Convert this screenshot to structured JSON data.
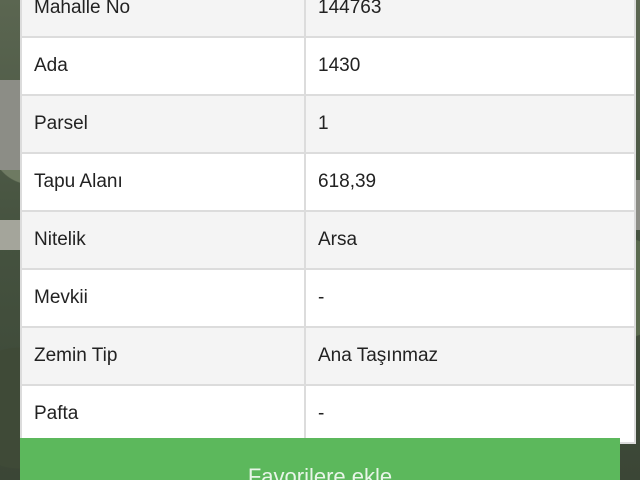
{
  "rows": [
    {
      "label": "Mahalle No",
      "value": "144763"
    },
    {
      "label": "Ada",
      "value": "1430"
    },
    {
      "label": "Parsel",
      "value": "1"
    },
    {
      "label": "Tapu Alanı",
      "value": "618,39"
    },
    {
      "label": "Nitelik",
      "value": "Arsa"
    },
    {
      "label": "Mevkii",
      "value": "-"
    },
    {
      "label": "Zemin Tip",
      "value": "Ana Taşınmaz"
    },
    {
      "label": "Pafta",
      "value": "-"
    }
  ],
  "actions": {
    "favorite_label": "Favorilere ekle"
  },
  "colors": {
    "button_green": "#5cb85c",
    "row_alt": "#f4f4f4",
    "border": "#dcdcdc"
  }
}
